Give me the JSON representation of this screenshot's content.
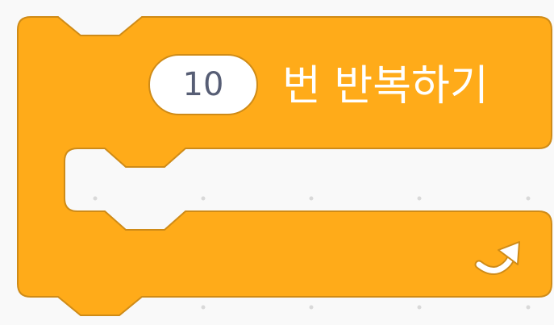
{
  "block": {
    "type": "control_repeat",
    "times_value": "10",
    "label": "번 반복하기",
    "icon": "loop-arrow-icon",
    "colors": {
      "fill": "#FFAB19",
      "border": "#CF8B17",
      "input_text": "#575E75",
      "label_text": "#FFFFFF",
      "workspace": "#F9F9F9"
    }
  }
}
